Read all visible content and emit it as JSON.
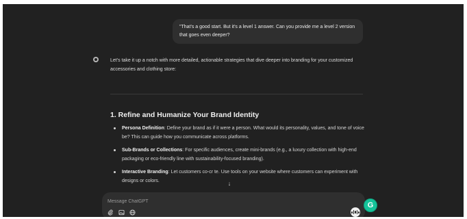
{
  "user_message": "\"That's a good start. But it's a level 1 answer. Can you provide me a level 2 version that goes even deeper?",
  "assistant": {
    "intro": "Let's take it up a notch with more detailed, actionable strategies that dive deeper into branding for your customized accessories and clothing store:",
    "section_heading": "1. Refine and Humanize Your Brand Identity",
    "bullets": [
      {
        "title": "Persona Definition",
        "text": ": Define your brand as if it were a person. What would its personality, values, and tone of voice be? This can guide how you communicate across platforms."
      },
      {
        "title": "Sub-Brands or Collections",
        "text": ": For specific audiences, create mini-brands (e.g., a luxury collection with high-end packaging or eco-friendly line with sustainability-focused branding)."
      },
      {
        "title": "Interactive Branding",
        "text": ": Let customers co-cr  te. Use tools on your website where customers can experiment with designs or colors."
      }
    ]
  },
  "composer": {
    "placeholder": "Message ChatGPT",
    "icons": [
      "paperclip-icon",
      "image-icon",
      "globe-icon"
    ],
    "voice_icon": "voice-icon"
  },
  "grammarly_label": "G",
  "colors": {
    "background": "#212121",
    "bubble": "#2f2f2f",
    "text": "#ececec",
    "grammarly": "#15c39a"
  }
}
